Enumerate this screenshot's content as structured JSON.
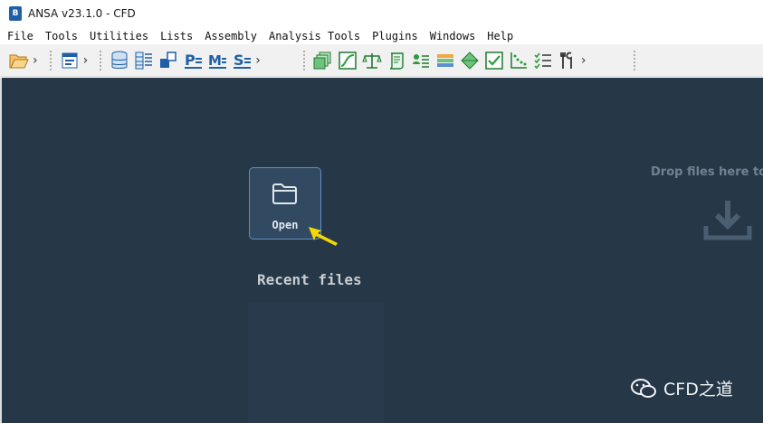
{
  "window": {
    "title": "ANSA v23.1.0 - CFD",
    "app_icon_letter": "B"
  },
  "menu": [
    "File",
    "Tools",
    "Utilities",
    "Lists",
    "Assembly",
    "Analysis Tools",
    "Plugins",
    "Windows",
    "Help"
  ],
  "toolbar": {
    "more_indicator": "›",
    "icons": [
      "folder-open-icon",
      "panel-icon",
      "database-icon",
      "cube-grid-icon",
      "parts-icon",
      "properties-p-icon",
      "materials-m-icon",
      "sets-s-icon",
      "layers-icon",
      "curve-icon",
      "balance-icon",
      "scroll-icon",
      "model-tree-icon",
      "stack-icon",
      "shape-icon",
      "check-icon",
      "chart-icon",
      "checklist-icon",
      "tools-icon"
    ]
  },
  "start": {
    "open_label": "Open",
    "recent_title": "Recent files",
    "drop_text": "Drop files here to"
  },
  "watermark": {
    "text": "CFD之道"
  },
  "colors": {
    "workspace": "#263747",
    "open_border": "#5d8fc4",
    "accent_green": "#2a9d3c",
    "accent_blue": "#1f5fa6",
    "arrow": "#f5d800"
  }
}
